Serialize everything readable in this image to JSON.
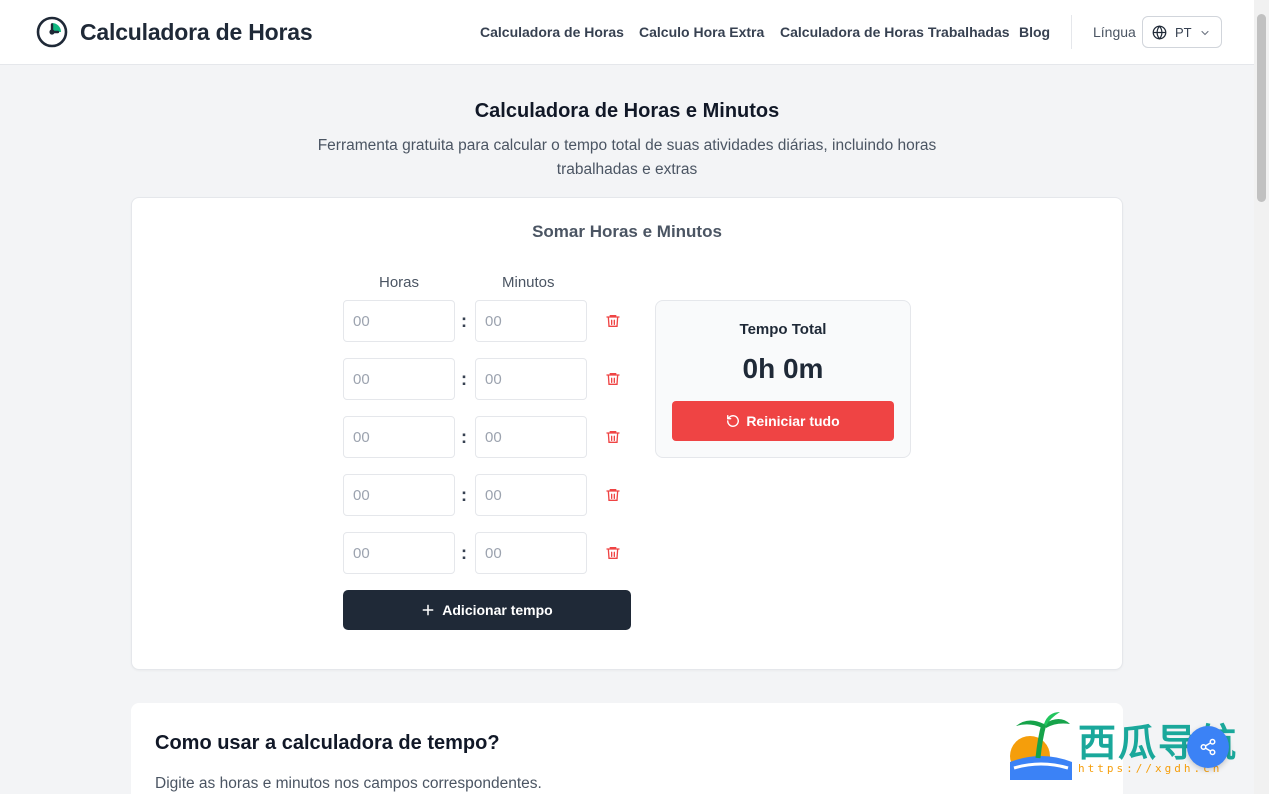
{
  "header": {
    "site_name": "Calculadora de Horas",
    "nav": [
      {
        "label": "Calculadora de Horas"
      },
      {
        "label": "Calculo Hora Extra"
      },
      {
        "label": "Calculadora de Horas Trabalhadas"
      },
      {
        "label": "Blog"
      }
    ],
    "language_label": "Língua",
    "language_code": "PT"
  },
  "page": {
    "title": "Calculadora de Horas e Minutos",
    "subtitle": "Ferramenta gratuita para calcular o tempo total de suas atividades diárias, incluindo horas trabalhadas e extras"
  },
  "calculator": {
    "title": "Somar Horas e Minutos",
    "hours_label": "Horas",
    "minutes_label": "Minutos",
    "rows": [
      {
        "hours_placeholder": "00",
        "minutes_placeholder": "00",
        "separator": ":"
      },
      {
        "hours_placeholder": "00",
        "minutes_placeholder": "00",
        "separator": ":"
      },
      {
        "hours_placeholder": "00",
        "minutes_placeholder": "00",
        "separator": ":"
      },
      {
        "hours_placeholder": "00",
        "minutes_placeholder": "00",
        "separator": ":"
      },
      {
        "hours_placeholder": "00",
        "minutes_placeholder": "00",
        "separator": ":"
      }
    ],
    "add_button": "Adicionar tempo",
    "total_label": "Tempo Total",
    "total_value": "0h 0m",
    "reset_button": "Reiniciar tudo"
  },
  "how_to": {
    "title": "Como usar a calculadora de tempo?",
    "text": "Digite as horas e minutos nos campos correspondentes."
  },
  "watermark": {
    "text": "西瓜导航",
    "url": "https://xgdh.cn"
  },
  "colors": {
    "primary_dark": "#1f2937",
    "danger": "#ef4444",
    "accent_green": "#10b981",
    "share_blue": "#3b82f6"
  },
  "icons": {
    "logo": "clock-icon",
    "language": "globe-icon",
    "dropdown": "chevron-down-icon",
    "delete": "trash-icon",
    "add": "plus-icon",
    "reset": "rotate-ccw-icon",
    "share": "share-icon"
  }
}
